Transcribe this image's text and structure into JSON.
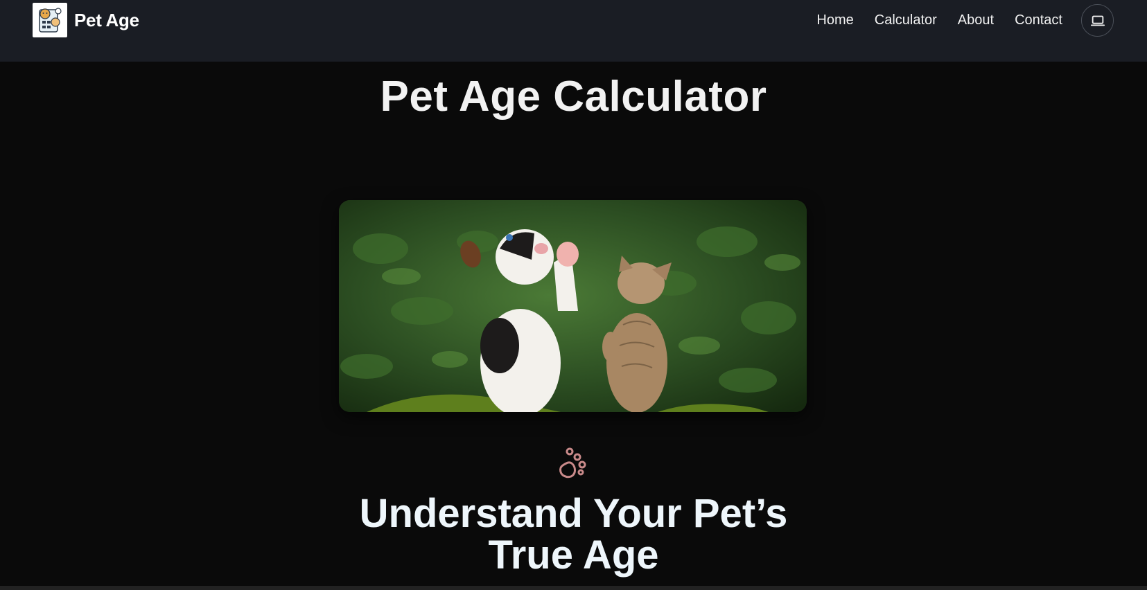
{
  "brand": {
    "name": "Pet Age",
    "logo_icon": "pet-calculator-logo-icon"
  },
  "nav": {
    "links": [
      "Home",
      "Calculator",
      "About",
      "Contact"
    ],
    "theme_toggle_icon": "laptop-icon"
  },
  "main": {
    "page_title": "Pet Age Calculator",
    "hero_image": "puppy-and-kitten-photo",
    "paw_icon": "paw-icon",
    "section_title_line1": "Understand Your Pet’s",
    "section_title_line2": "True Age"
  },
  "colors": {
    "navbar_bg": "#1a1d24",
    "page_bg": "#0a0a0a",
    "paw_accent": "#c98a8a",
    "heading_text": "#eef6fb"
  }
}
